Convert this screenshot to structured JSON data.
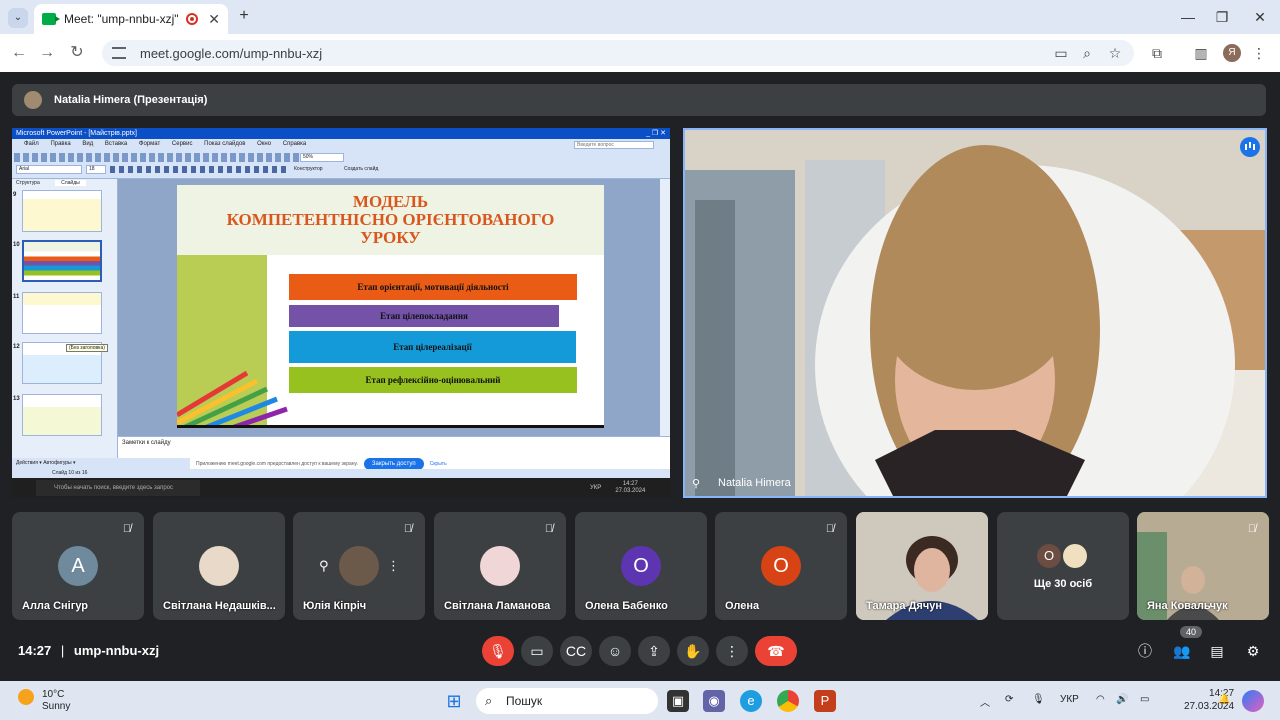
{
  "browser": {
    "tab_title": "Meet: \"ump-nnbu-xzj\"",
    "url": "meet.google.com/ump-nnbu-xzj",
    "profile_initial": "Я"
  },
  "meet": {
    "presenter_bar": "Natalia Himera (Презентація)",
    "main_video_name": "Natalia Himera",
    "time": "14:27",
    "meeting_code": "ump-nnbu-xzj",
    "participant_count": "40",
    "participants": [
      {
        "name": "Алла Снігур",
        "initial": "А",
        "color": "#6e8a9c"
      },
      {
        "name": "Світлана Недашків...",
        "initial": "",
        "color": ""
      },
      {
        "name": "Юлія Кіпріч",
        "initial": "",
        "color": ""
      },
      {
        "name": "Світлана Ламанова",
        "initial": "",
        "color": ""
      },
      {
        "name": "Олена Бабенко",
        "initial": "О",
        "color": "#5e35b1"
      },
      {
        "name": "Олена",
        "initial": "О",
        "color": "#d84315"
      },
      {
        "name": "Тамара Дячун",
        "initial": "",
        "color": ""
      },
      {
        "name": "Ще 30 осіб",
        "initial": "О",
        "color": "#6d4c41"
      },
      {
        "name": "Яна Ковальчук",
        "initial": "",
        "color": ""
      }
    ]
  },
  "ppt": {
    "window_title": "Microsoft PowerPoint - [Майстрів.pptx]",
    "menu": [
      "Файл",
      "Правка",
      "Вид",
      "Вставка",
      "Формат",
      "Сервис",
      "Показ слайдов",
      "Окно",
      "Справка"
    ],
    "help_box": "Введите вопрос",
    "zoom": "50%",
    "font": "Arial",
    "font_size": "18",
    "designer": "Конструктор",
    "new_slide": "Создать слайд",
    "tabs": [
      "Структура",
      "Слайды"
    ],
    "thumb_numbers": [
      "9",
      "10",
      "11",
      "12",
      "13"
    ],
    "no_title_tooltip": "(Без заголовка)",
    "notes_placeholder": "Заметки к слайду",
    "draw_bar": "Действия ▾  Автофигуры ▾",
    "status": "Слайд 10 из 16",
    "share_notice": "Приложению meet.google.com предоставлен доступ к вашему экрану.",
    "share_button": "Закрыть доступ",
    "share_hide": "Скрыть",
    "taskbar_search": "Чтобы начать поиск, введите здесь запрос",
    "taskbar_lang": "УКР",
    "taskbar_time": "14:27",
    "taskbar_date": "27.03.2024"
  },
  "slide": {
    "title_lines": [
      "МОДЕЛЬ",
      "КОМПЕТЕНТНІСНО  ОРІЄНТОВАНОГО",
      "УРОКУ"
    ],
    "stages": [
      {
        "text": "Етап орієнтації, мотивації діяльності",
        "color": "#ea5b16"
      },
      {
        "text": "Етап цілепокладання",
        "color": "#7352a8"
      },
      {
        "text": "Етап цілереалізації",
        "color": "#159ad9"
      },
      {
        "text": "Етап рефлексійно-оцінювальний",
        "color": "#96c11f"
      }
    ]
  },
  "taskbar": {
    "temp": "10°C",
    "weather": "Sunny",
    "search": "Пошук",
    "lang": "УКР",
    "time": "14:27",
    "date": "27.03.2024"
  }
}
